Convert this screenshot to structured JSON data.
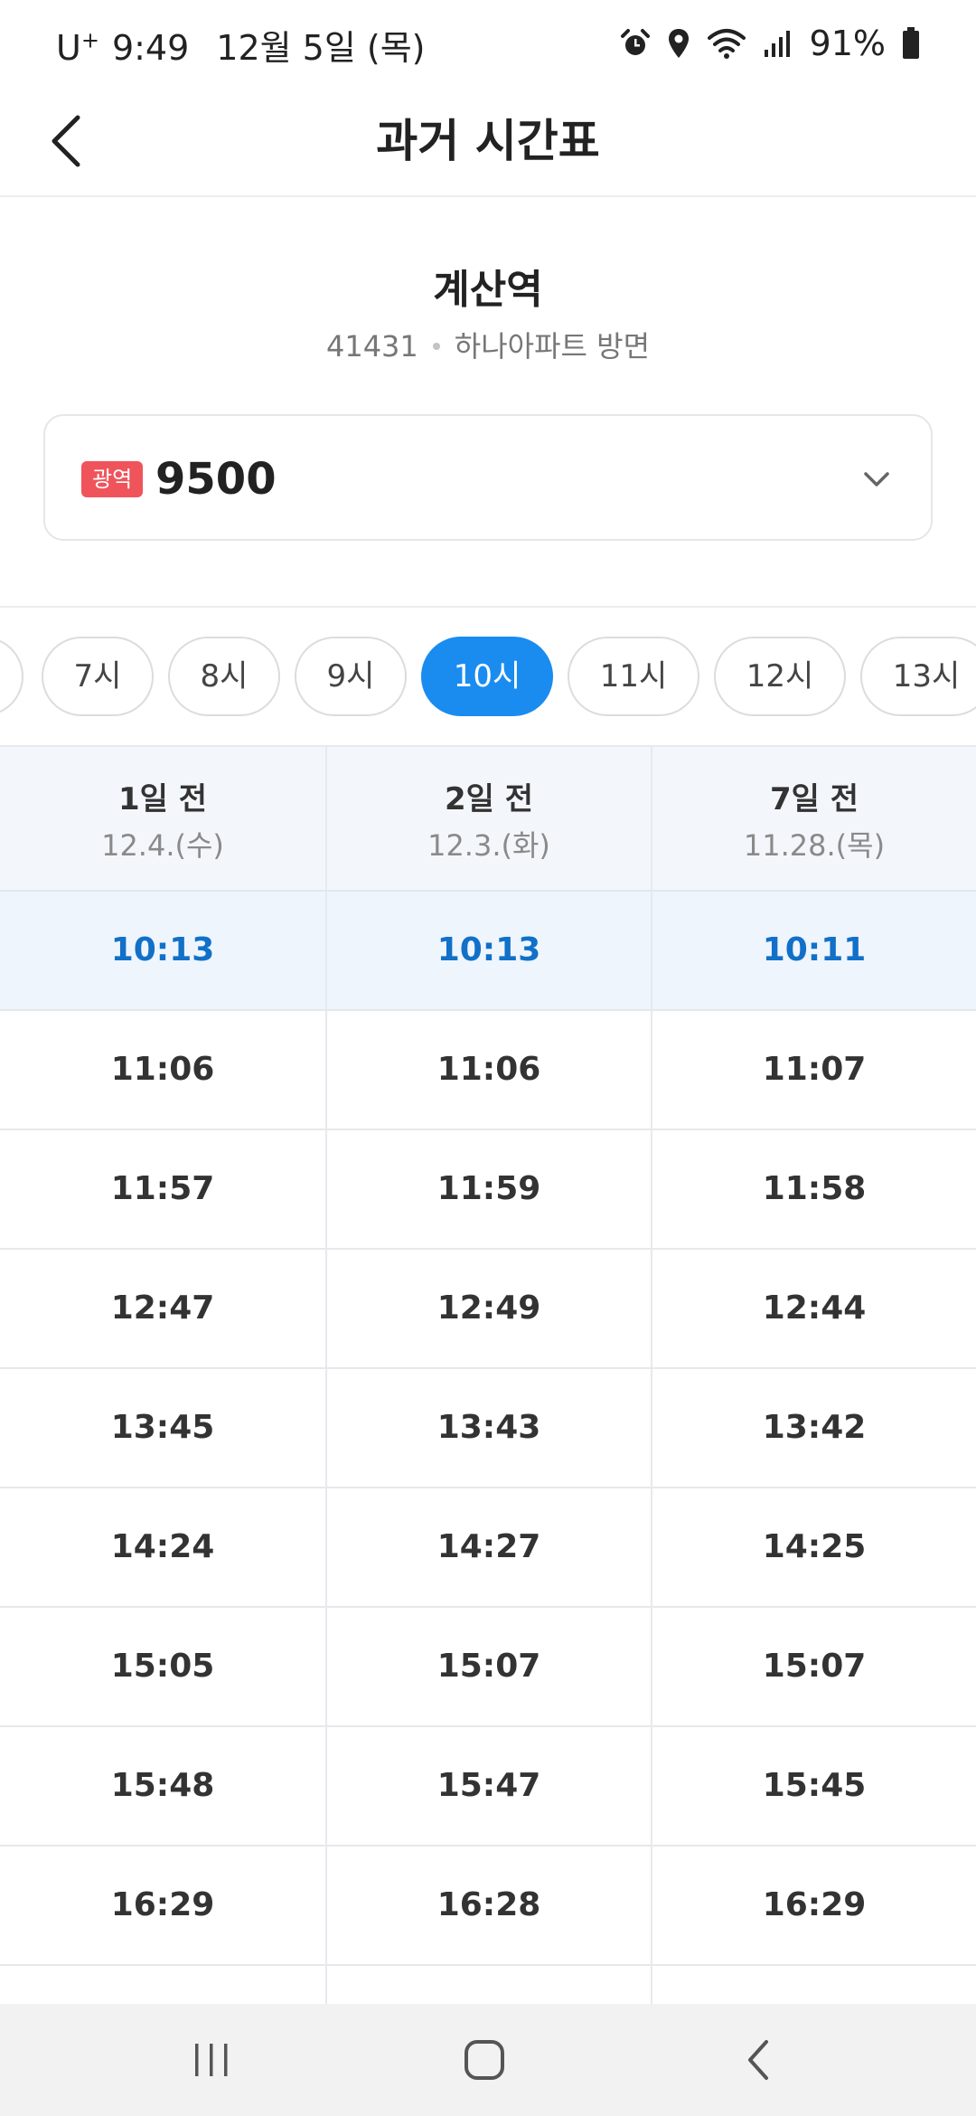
{
  "status_bar": {
    "carrier": "U",
    "carrier_plus": "+",
    "time": "9:49",
    "date": "12월 5일 (목)",
    "battery": "91%",
    "icons": [
      "alarm-icon",
      "location-icon",
      "wifi-icon",
      "signal-icon",
      "battery-icon"
    ]
  },
  "header": {
    "title": "과거 시간표",
    "back_icon": "chevron-left-icon"
  },
  "station": {
    "name": "계산역",
    "id": "41431",
    "direction": "하나아파트 방면"
  },
  "route": {
    "badge": "광역",
    "badge_color": "#f0545b",
    "number": "9500",
    "chevron_icon": "chevron-down-icon"
  },
  "hours": {
    "items": [
      "7시",
      "8시",
      "9시",
      "10시",
      "11시",
      "12시",
      "13시"
    ],
    "selected": "10시",
    "accent_color": "#1a8cf0"
  },
  "table": {
    "columns": [
      {
        "day": "1일 전",
        "date": "12.4.(수)"
      },
      {
        "day": "2일 전",
        "date": "12.3.(화)"
      },
      {
        "day": "7일 전",
        "date": "11.28.(목)"
      }
    ],
    "rows": [
      [
        "10:13",
        "10:13",
        "10:11"
      ],
      [
        "11:06",
        "11:06",
        "11:07"
      ],
      [
        "11:57",
        "11:59",
        "11:58"
      ],
      [
        "12:47",
        "12:49",
        "12:44"
      ],
      [
        "13:45",
        "13:43",
        "13:42"
      ],
      [
        "14:24",
        "14:27",
        "14:25"
      ],
      [
        "15:05",
        "15:07",
        "15:07"
      ],
      [
        "15:48",
        "15:47",
        "15:45"
      ],
      [
        "16:29",
        "16:28",
        "16:29"
      ]
    ],
    "highlight_color": "#1170c8"
  },
  "nav_bar": {
    "icons": [
      "recent-apps-icon",
      "home-icon",
      "back-icon"
    ]
  }
}
